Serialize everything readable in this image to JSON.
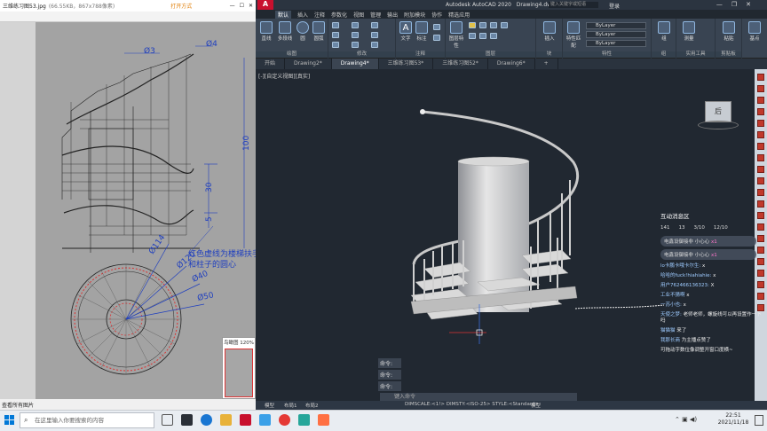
{
  "viewer": {
    "title": "三维练习图53.jpg",
    "meta": "(66.55KB，867x788像素)",
    "open_with": "打开方式",
    "thumb_label": "鸟瞰图 120%",
    "bottom_items": [
      "查看所有图片"
    ],
    "annotations": {
      "d3": "Ø3",
      "d4": "Ø4",
      "h100": "100",
      "h30": "30",
      "h5": "5",
      "note_line1": "红色虚线为楼梯扶手",
      "note_line2": "和柱子的圆心",
      "d114": "Ø114",
      "d120": "Ø120",
      "d40": "Ø40",
      "d50": "Ø50"
    }
  },
  "acad": {
    "app_title": "Autodesk AutoCAD 2020",
    "doc_title": "Drawing4.dwg",
    "search_placeholder": "键入关键字或短语",
    "user": "登录",
    "ribbon_tabs": [
      "默认",
      "插入",
      "注释",
      "参数化",
      "视图",
      "管理",
      "输出",
      "附加模块",
      "协作",
      "精选应用"
    ],
    "active_tab": "默认",
    "groups": {
      "draw": "绘图",
      "modify": "修改",
      "annotate": "注释",
      "layers": "图层",
      "block": "块",
      "properties": "特性",
      "groups": "组",
      "utilities": "实用工具",
      "clipboard": "剪贴板",
      "base": "基点"
    },
    "buttons": {
      "line": "直线",
      "polyline": "多段线",
      "circle": "圆",
      "arc": "圆弧",
      "text": "文字",
      "dimension": "标注",
      "layer_props": "图层特性",
      "insert": "插入",
      "match_props": "特性匹配",
      "group": "组",
      "measure": "测量",
      "paste": "粘贴",
      "base": "基点"
    },
    "bylayer": [
      "ByLayer",
      "ByLayer",
      "ByLayer"
    ],
    "doc_tabs": [
      "开始",
      "Drawing2*",
      "Drawing4*",
      "三维练习图53*",
      "三维练习图52*",
      "Drawing6*"
    ],
    "active_doc": "Drawing4*",
    "viewport_label": "[-][自定义视图][真实]",
    "viewcube_label": "后",
    "command_lines": [
      "命令:",
      "命令:",
      "命令:"
    ],
    "command_placeholder": "键入命令",
    "layout_tabs": [
      "模型",
      "布局1",
      "布局2"
    ],
    "status_text": "DIMSCALE:<1!> DIMSTY:<ISO-25> STYLE:<Standard>",
    "status_model": "模型"
  },
  "chat": {
    "title": "互动消息区",
    "stats": [
      "141",
      "13",
      "3/10",
      "12/10"
    ],
    "pills": [
      {
        "text": "电鑫设御接非 小心心",
        "count": "x1"
      },
      {
        "text": "电鑫设御接非 小心心",
        "count": "x1"
      }
    ],
    "messages": [
      {
        "user": "lo卡鹏卡哦卡尔生:",
        "text": "x"
      },
      {
        "user": "哈哈的fuck!hiahiahie:",
        "text": "x"
      },
      {
        "user": "用户762466136323:",
        "text": "X"
      },
      {
        "user": "工业不猜啊",
        "text": "x"
      },
      {
        "user": "一苏小也:",
        "text": "x"
      },
      {
        "user": "天使之梦:",
        "text": "老师老师，螺旋线可以再设置作一下吗"
      },
      {
        "user": "猫猫猫",
        "text": "来了"
      },
      {
        "user": "我那长商",
        "text": "为主播点赞了"
      },
      {
        "user": "",
        "text": "可拖动字数位像调整开窗口度横~"
      }
    ]
  },
  "taskbar": {
    "search_placeholder": "在这里输入你要搜索的内容",
    "time": "22:51",
    "date": "2021/11/18"
  }
}
